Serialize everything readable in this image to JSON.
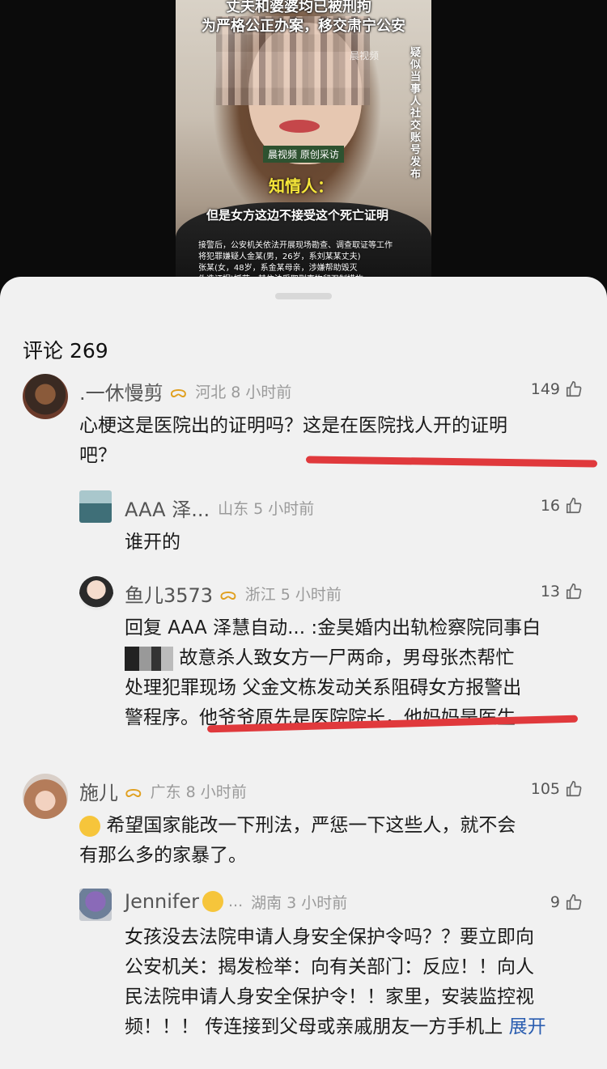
{
  "video": {
    "line1": "丈夫和婆婆均已被刑拘",
    "line2": "为严格公正办案，移交肃宁公安",
    "vertical_caption": "疑似当事人社交账号发布",
    "watermark": "晨视频",
    "badge": "晨视频 原创采访",
    "speaker": "知情人：",
    "quote": "但是女方这边不接受这个死亡证明",
    "notice1": "接警后，公安机关依法开展现场勘查、调查取证等工作",
    "notice2": "将犯罪嫌疑人金某(男，26岁，系刘某某丈夫)",
    "notice3": "张某(女，48岁，系金某母亲，涉嫌帮助毁灭",
    "notice4": "伪造证据)抓获，其依法采取刑事拘留强制措施"
  },
  "sheet": {
    "title": "评论 269"
  },
  "comments": [
    {
      "name": ".一休慢剪",
      "vip": "ᯅ",
      "meta": "河北  8 小时前",
      "likes": "149",
      "text1": "心梗这是医院出的证明吗？这是在医院找人开的证明",
      "text2": "吧？"
    },
    {
      "name": "AAA 泽...",
      "meta": "山东  5 小时前",
      "likes": "16",
      "text1": "谁开的"
    },
    {
      "name": "鱼儿3573",
      "vip": "ᯅ",
      "meta": "浙江  5 小时前",
      "likes": "13",
      "text1": "回复 AAA 泽慧自动... :金昊婚内出轨检察院同事白",
      "text2": "故意杀人致女方一尸两命，男母张杰帮忙",
      "text3": "处理犯罪现场 父金文栋发动关系阻碍女方报警出",
      "text4": "警程序。他爷爷原先是医院院长，他妈妈是医生"
    },
    {
      "name": "施儿",
      "vip": "ᯅ",
      "meta": "广东  8 小时前",
      "likes": "105",
      "text1": "希望国家能改一下刑法，严惩一下这些人，就不会",
      "text2": "有那么多的家暴了。"
    },
    {
      "name": "Jennifer",
      "name_suffix": "...",
      "meta": "湖南  3 小时前",
      "likes": "9",
      "text1": "女孩没去法院申请人身安全保护令吗？？要立即向",
      "text2": "公安机关：揭发检举：向有关部门：反应！！向人",
      "text3": "民法院申请人身安全保护令！！家里，安装监控视",
      "text4": "频！！！ 传连接到父母或亲戚朋友一方手机上",
      "expand": "展开"
    }
  ]
}
